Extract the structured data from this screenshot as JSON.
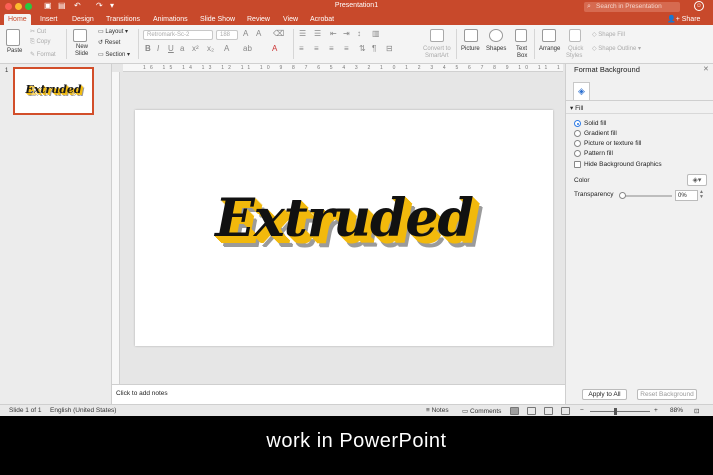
{
  "window": {
    "title": "Presentation1",
    "search_placeholder": "Search in Presentation",
    "share_label": "Share"
  },
  "tabs": [
    "Home",
    "Insert",
    "Design",
    "Transitions",
    "Animations",
    "Slide Show",
    "Review",
    "View",
    "Acrobat"
  ],
  "ribbon": {
    "paste": "Paste",
    "cut": "Cut",
    "copy": "Copy",
    "format": "Format",
    "new_slide": "New",
    "new_slide2": "Slide",
    "layout": "Layout",
    "reset": "Reset",
    "section": "Section",
    "font_name": "Retromark-Sc-2",
    "font_size": "188",
    "convert_smartart": "Convert to",
    "convert_smartart2": "SmartArt",
    "picture": "Picture",
    "shapes": "Shapes",
    "text_box": "Text",
    "text_box2": "Box",
    "arrange": "Arrange",
    "quick_styles": "Quick",
    "quick_styles2": "Styles",
    "shape_fill": "Shape Fill",
    "shape_outline": "Shape Outline"
  },
  "slides_panel": {
    "slide_number": "1",
    "thumb_text": "Extruded"
  },
  "slide": {
    "text": "Extruded"
  },
  "notes": {
    "placeholder": "Click to add notes"
  },
  "format_panel": {
    "title": "Format Background",
    "section": "Fill",
    "options": [
      "Solid fill",
      "Gradient fill",
      "Picture or texture fill",
      "Pattern fill"
    ],
    "hide_graphics": "Hide Background Graphics",
    "color_label": "Color",
    "transparency_label": "Transparency",
    "transparency_value": "0%",
    "apply_all": "Apply to All",
    "reset_bg": "Reset Background"
  },
  "status": {
    "slide_info": "Slide 1 of 1",
    "language": "English (United States)",
    "notes": "Notes",
    "comments": "Comments",
    "zoom": "88%"
  },
  "caption": "work in PowerPoint",
  "colors": {
    "accent": "#c8492b",
    "extrude": "#f2b90c",
    "shadow": "#9b9b9b"
  }
}
